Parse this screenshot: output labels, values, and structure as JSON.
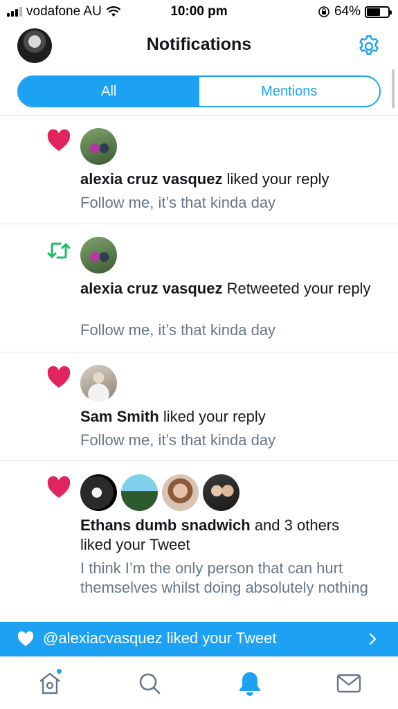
{
  "status_bar": {
    "carrier": "vodafone AU",
    "time": "10:00 pm",
    "battery_percent": "64%",
    "battery_level": 0.64
  },
  "header": {
    "title": "Notifications"
  },
  "tabs": {
    "all": "All",
    "mentions": "Mentions",
    "active": "all"
  },
  "notifications": [
    {
      "type": "like",
      "icon": "heart-icon",
      "actor": "alexia cruz vasquez",
      "action": " liked your reply",
      "tweet": "Follow me, it’s that kinda day"
    },
    {
      "type": "retweet",
      "icon": "retweet-icon",
      "actor": "alexia cruz vasquez",
      "action": " Retweeted your reply",
      "tweet": "Follow me, it’s that kinda day"
    },
    {
      "type": "like",
      "icon": "heart-icon",
      "actor": "Sam Smith",
      "action": " liked your reply",
      "tweet": "Follow me, it’s that kinda day"
    },
    {
      "type": "like",
      "icon": "heart-icon",
      "actor": "Ethans dumb snadwich",
      "action": " and 3 others liked your Tweet",
      "tweet": "I think I’m the only person that can hurt themselves whilst doing absolutely nothing"
    }
  ],
  "banner": {
    "text": "@alexiacvasquez liked your Tweet"
  },
  "tabbar": {
    "items": [
      "home-icon",
      "search-icon",
      "bell-icon",
      "mail-icon"
    ],
    "active": "bell-icon"
  },
  "colors": {
    "accent": "#1da1f2",
    "like": "#e0245e",
    "retweet": "#17bf63",
    "secondary_text": "#657786"
  }
}
